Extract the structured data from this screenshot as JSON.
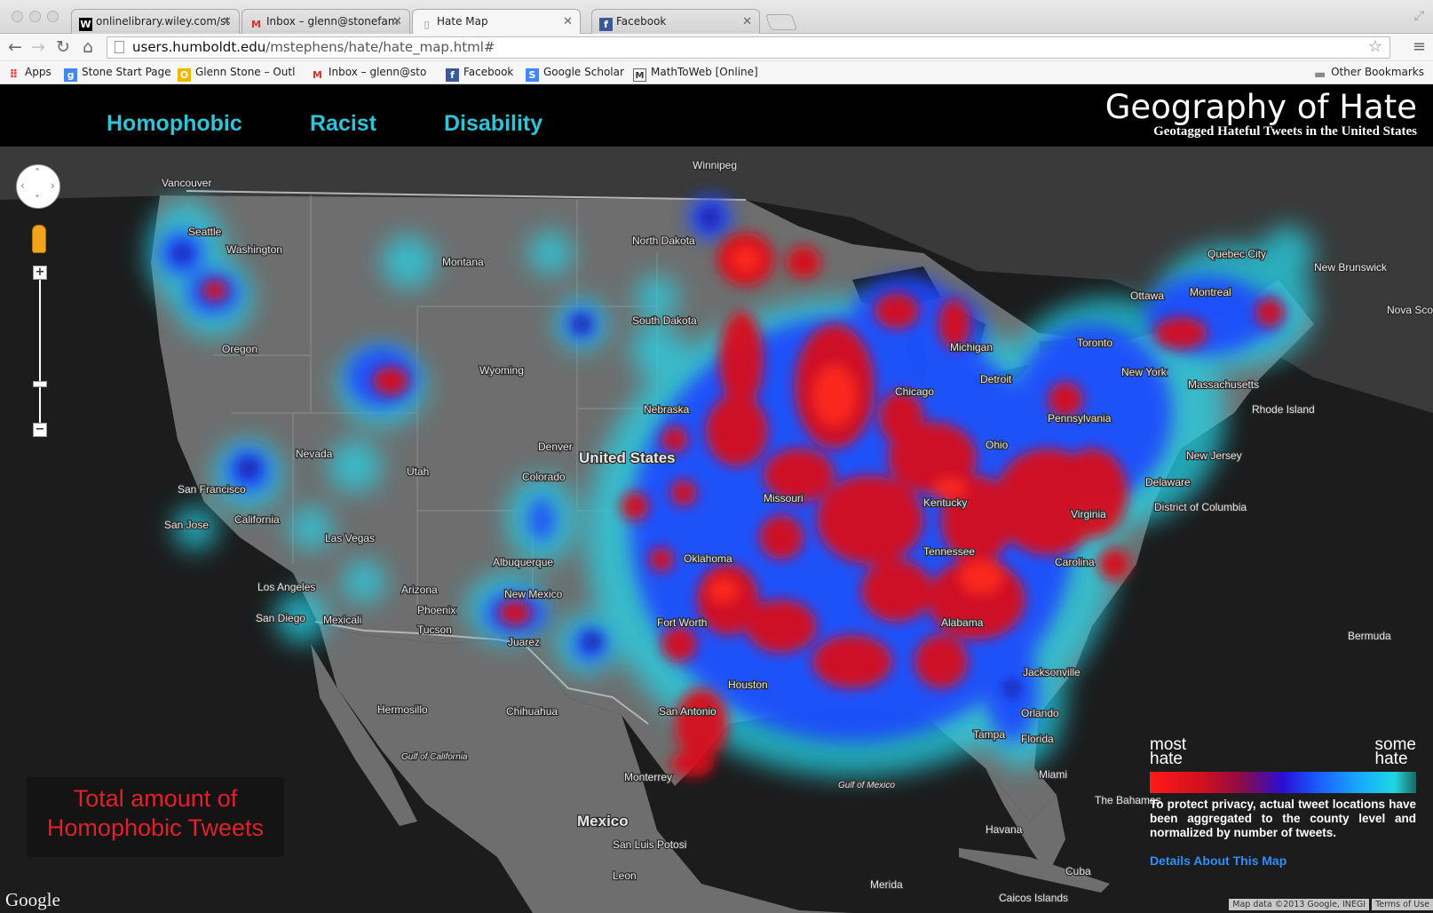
{
  "browser": {
    "tabs": [
      {
        "favicon": "wiley-icon",
        "title": "onlinelibrary.wiley.com/sto",
        "active": false
      },
      {
        "favicon": "gmail-icon",
        "title": "Inbox – glenn@stonefamily",
        "active": false
      },
      {
        "favicon": "document-icon",
        "title": "Hate Map",
        "active": true
      },
      {
        "favicon": "facebook-icon",
        "title": "Facebook",
        "active": false
      }
    ],
    "url_host": "users.humboldt.edu",
    "url_path": "/mstephens/hate/hate_map.html#",
    "bookmarks": [
      {
        "icon": "apps-icon",
        "label": "Apps"
      },
      {
        "icon": "google-icon",
        "label": "Stone Start Page"
      },
      {
        "icon": "outlook-icon",
        "label": "Glenn Stone – Outlo"
      },
      {
        "icon": "gmail-icon",
        "label": "Inbox – glenn@ston"
      },
      {
        "icon": "facebook-icon",
        "label": "Facebook"
      },
      {
        "icon": "scholar-icon",
        "label": "Google Scholar"
      },
      {
        "icon": "mathtoweb-icon",
        "label": "MathToWeb [Online]"
      }
    ],
    "other_bookmarks": "Other Bookmarks"
  },
  "header": {
    "nav": [
      "Homophobic",
      "Racist",
      "Disability"
    ],
    "title": "Geography of Hate",
    "subtitle": "Geotagged Hateful Tweets in the United States"
  },
  "map": {
    "total_line1": "Total amount of",
    "total_line2": "Homophobic Tweets",
    "legend_most_1": "most",
    "legend_most_2": "hate",
    "legend_some_1": "some",
    "legend_some_2": "hate",
    "privacy_note": "To protect privacy, actual tweet locations have been aggregated to the county level and normalized by number of tweets.",
    "details_link": "Details About This Map",
    "google_logo": "Google",
    "attribution": "Map data ©2013 Google, INEGI",
    "terms": "Terms of Use",
    "labels": [
      "Winnipeg",
      "Vancouver",
      "Seattle",
      "Washington",
      "Montana",
      "North Dakota",
      "South Dakota",
      "Oregon",
      "Wyoming",
      "Nebraska",
      "Nevada",
      "Utah",
      "United States",
      "Denver",
      "Colorado",
      "San Francisco",
      "California",
      "San Jose",
      "Las Vegas",
      "Albuquerque",
      "Oklahoma",
      "Los Angeles",
      "Arizona",
      "Phoenix",
      "New Mexico",
      "San Diego",
      "Mexicali",
      "Tucson",
      "Juarez",
      "Hermosillo",
      "Chihuahua",
      "Gulf of California",
      "Monterrey",
      "Mexico",
      "San Luis Potosi",
      "Leon",
      "Merida",
      "Quebec City",
      "New Brunswick",
      "Ottawa",
      "Montreal",
      "Nova Scotia",
      "Toronto",
      "New York",
      "Massachusetts",
      "Rhode Island",
      "New Jersey",
      "Delaware",
      "District of Columbia",
      "Virginia",
      "Carolina",
      "Detroit",
      "Chicago",
      "Michigan",
      "Pennsylvania",
      "Missouri",
      "Kentucky",
      "Jacksonville",
      "Orlando",
      "Tampa",
      "Florida",
      "Miami",
      "Bermuda",
      "The Bahamas",
      "Havana",
      "Cuba",
      "Gulf of Mexico",
      "Caicos Islands",
      "Fort Worth",
      "Houston",
      "San Antonio",
      "Ohio",
      "Tennessee",
      "Alabama"
    ]
  },
  "legend_colors": [
    "#ff1a1a",
    "#d0101e",
    "#8a0b4a",
    "#2a0ed6",
    "#1a5cff",
    "#18a7ff",
    "#1fd6e0",
    "#1ed2cc"
  ]
}
